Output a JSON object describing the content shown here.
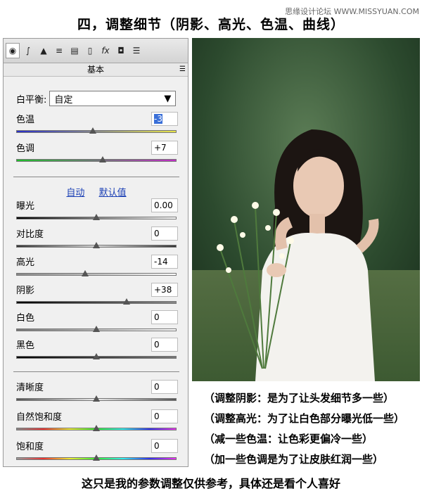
{
  "watermark": "思缘设计论坛 WWW.MISSYUAN.COM",
  "title": "四，调整细节（阴影、高光、色温、曲线）",
  "panel": {
    "section_title": "基本",
    "tabs": [
      "camera-icon",
      "curve-icon",
      "detail-icon",
      "hsl-icon",
      "split-tone-icon",
      "lens-icon",
      "fx-icon",
      "camera-calibration-icon",
      "presets-icon"
    ],
    "white_balance": {
      "label": "白平衡:",
      "value": "自定"
    },
    "auto_label": "自动",
    "default_label": "默认值",
    "sliders": [
      {
        "label": "色温",
        "value": "-3",
        "selected": true,
        "level": 0.48
      },
      {
        "label": "色调",
        "value": "+7",
        "level": 0.54
      },
      {
        "label": "曝光",
        "value": "0.00",
        "level": 0.5
      },
      {
        "label": "对比度",
        "value": "0",
        "level": 0.5
      },
      {
        "label": "高光",
        "value": "-14",
        "level": 0.43
      },
      {
        "label": "阴影",
        "value": "+38",
        "level": 0.69
      },
      {
        "label": "白色",
        "value": "0",
        "level": 0.5
      },
      {
        "label": "黑色",
        "value": "0",
        "level": 0.5
      },
      {
        "label": "清晰度",
        "value": "0",
        "level": 0.5
      },
      {
        "label": "自然饱和度",
        "value": "0",
        "level": 0.5
      },
      {
        "label": "饱和度",
        "value": "0",
        "level": 0.5
      }
    ]
  },
  "notes": [
    "（调整阴影：是为了让头发细节多一些）",
    "（调整高光：为了让白色部分曝光低一些）",
    "（减一些色温：让色彩更偏冷一些）",
    "（加一些色调是为了让皮肤红润一些）"
  ],
  "footer": "这只是我的参数调整仅供参考，具体还是看个人喜好"
}
